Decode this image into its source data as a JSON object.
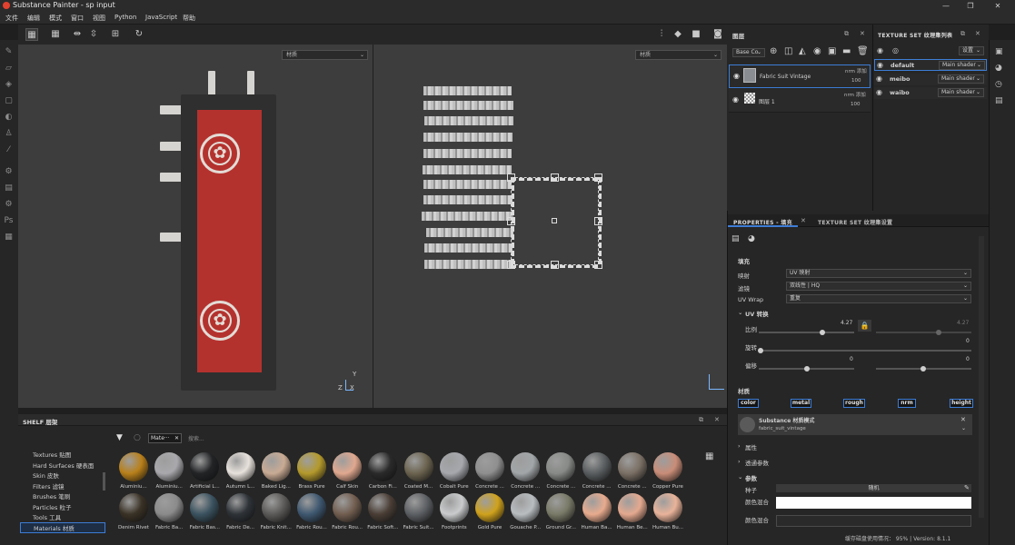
{
  "window": {
    "title": "Substance Painter - sp input",
    "controls": [
      "—",
      "❐",
      "✕"
    ]
  },
  "menu": [
    "文件",
    "编辑",
    "模式",
    "窗口",
    "视图",
    "Python",
    "JavaScript",
    "帮助"
  ],
  "viewport": {
    "left_select": "材质",
    "right_select": "材质",
    "axis_labels": {
      "z": "Z",
      "x": "X",
      "y": "Y"
    }
  },
  "shelf": {
    "title": "SHELF 层架",
    "filter_chip": "Mate···",
    "search_placeholder": "搜索...",
    "categories": [
      "Textures 贴图",
      "Hard Surfaces 硬表面",
      "Skin 皮肤",
      "Filters 滤镜",
      "Brushes 笔刷",
      "Particles 粒子",
      "Tools 工具",
      "Materials 材质"
    ],
    "selected_category": "Materials 材质",
    "materials_row1": [
      "Aluminiu...",
      "Aluminiu...",
      "Artificial L...",
      "Autumn L...",
      "Baked Lig...",
      "Brass Pure",
      "Calf Skin",
      "Carbon Fi...",
      "Coated M...",
      "Cobalt Pure",
      "Concrete ...",
      "Concrete ...",
      "Concrete ...",
      "Concrete ...",
      "Concrete ...",
      "Copper Pure"
    ],
    "materials_row2": [
      "Denim Rivet",
      "Fabric Ba...",
      "Fabric Bas...",
      "Fabric De...",
      "Fabric Knit...",
      "Fabric Rou...",
      "Fabric Rou...",
      "Fabric Soft...",
      "Fabric Suit...",
      "Footprints",
      "Gold Pure",
      "Gouache P...",
      "Ground Gr...",
      "Human Ba...",
      "Human Be...",
      "Human Bu..."
    ],
    "colors_row1": [
      "#b9801a",
      "#a9a9ad",
      "#222426",
      "#e8e2dc",
      "#c9ab94",
      "#b49a2c",
      "#e0a88f",
      "#2a2a2a",
      "#6c6450",
      "#a6a8ad",
      "#8f8f8f",
      "#a2a6a8",
      "#878a87",
      "#5a5e60",
      "#7b7065",
      "#c98d78"
    ],
    "colors_row2": [
      "#3a3226",
      "#8b8b8b",
      "#3b5360",
      "#2e3338",
      "#5c5a58",
      "#3f5870",
      "#725e50",
      "#4a3e36",
      "#5d6064",
      "#c9cbcc",
      "#d0a21c",
      "#b9bdc0",
      "#7a7a68",
      "#e8ab8e",
      "#e4a98f",
      "#e9b39a"
    ]
  },
  "layers": {
    "title": "图层",
    "blend_select": "Base Co",
    "items": [
      {
        "name": "Fabric Suit Vintage",
        "mode": "nrm 添加",
        "opacity": "100"
      },
      {
        "name": "图层 1",
        "mode": "nrm 添加",
        "opacity": "100"
      }
    ]
  },
  "texture_sets": {
    "title": "TEXTURE SET 纹理集列表",
    "settings_button": "设置",
    "items": [
      {
        "name": "default",
        "shader": "Main shader"
      },
      {
        "name": "meibo",
        "shader": "Main shader"
      },
      {
        "name": "waibo",
        "shader": "Main shader"
      }
    ]
  },
  "properties": {
    "tab_active": "PROPERTIES - 填充",
    "tab_other": "TEXTURE SET 纹理集设置",
    "section_fill": "填充",
    "projection_label": "映射",
    "projection_value": "UV 映射",
    "filtering_label": "滤镜",
    "filtering_value": "双线性 | HQ",
    "uvwrap_label": "UV Wrap",
    "uvwrap_value": "重复",
    "uv_transform_title": "UV 转换",
    "scale_label": "比例",
    "scale_value": "4.27",
    "scale_value2": "4.27",
    "rotation_label": "旋转",
    "rotation_value": "0",
    "offset_label": "偏移",
    "offset_value_a": "0",
    "offset_value_b": "0",
    "material_title": "材质",
    "channels": [
      "color",
      "metal",
      "rough",
      "nrm",
      "height"
    ],
    "substance_title": "Substance 材质模式",
    "substance_name": "fabric_suit_vintage",
    "attributes": "属性",
    "tech_params": "透通参数",
    "params": "参数",
    "seed_label": "种子",
    "seed_value": "随机",
    "color_label_1": "颜色混合",
    "color_label_2": "颜色混合"
  },
  "status": {
    "text": "缓存磁盘使用情况：   95%  |  Version: 8.1.1"
  }
}
